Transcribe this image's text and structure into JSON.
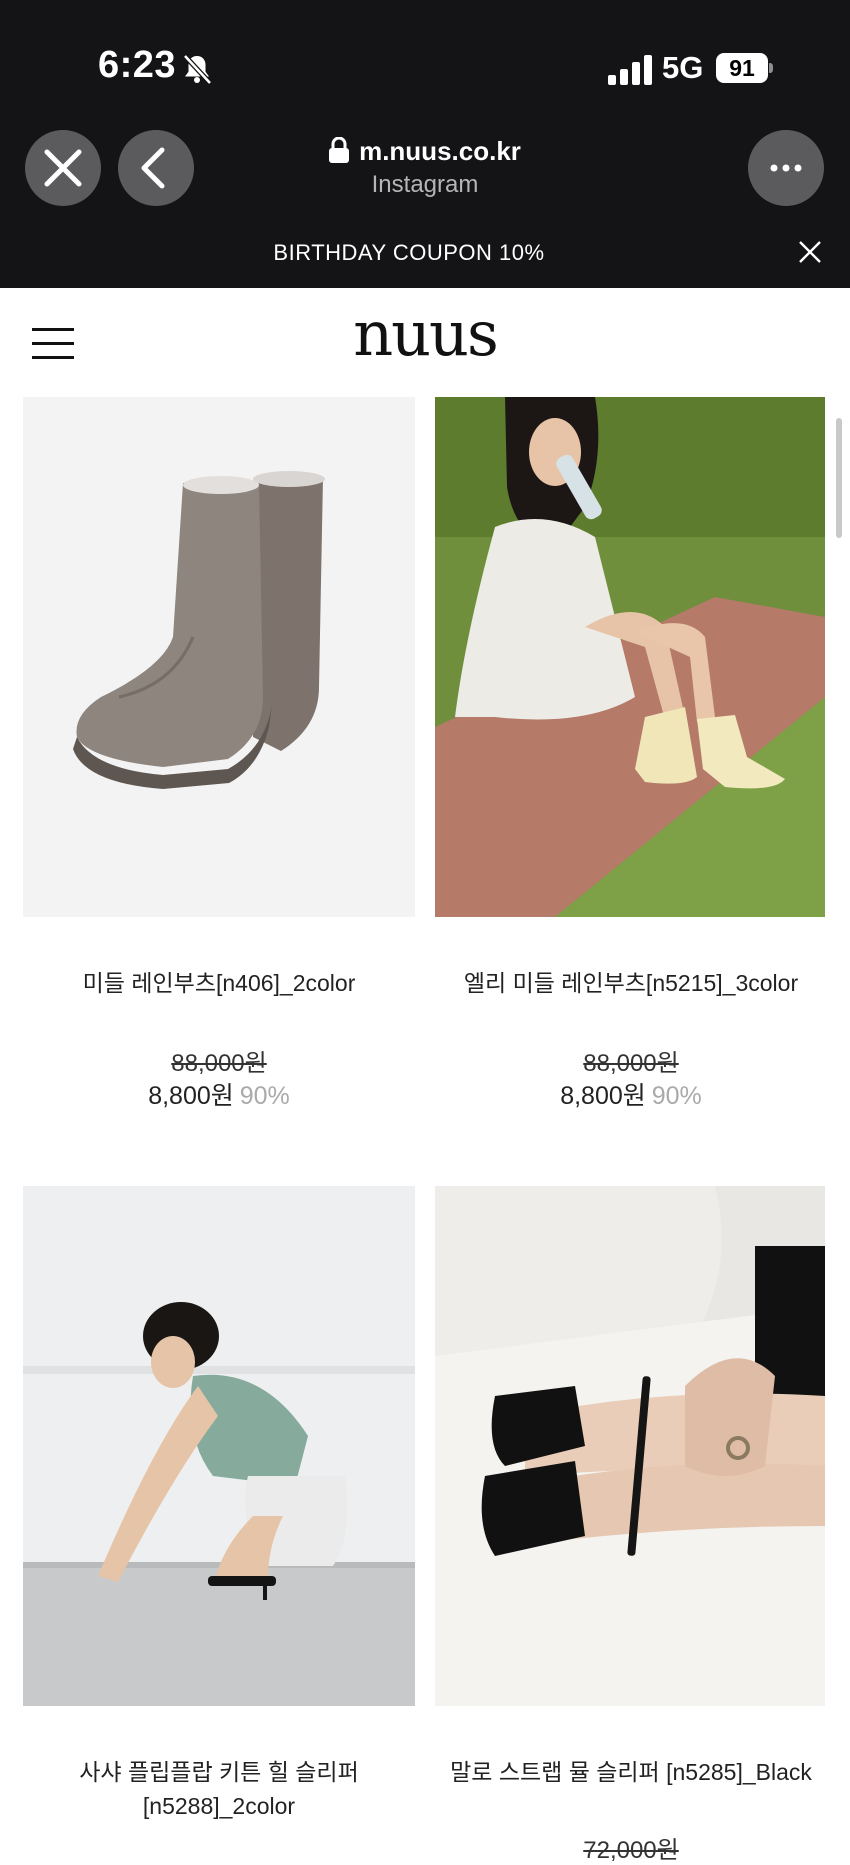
{
  "status": {
    "time": "6:23",
    "network": "5G",
    "battery": "91"
  },
  "browser": {
    "url": "m.nuus.co.kr",
    "source": "Instagram"
  },
  "banner": {
    "text": "BIRTHDAY COUPON 10%"
  },
  "site": {
    "logo": "nuus"
  },
  "products": [
    {
      "name": "미들 레인부츠[n406]_2color",
      "original_price": "88,000원",
      "price": "8,800원",
      "discount": "90%"
    },
    {
      "name": "엘리 미들 레인부츠[n5215]_3color",
      "original_price": "88,000원",
      "price": "8,800원",
      "discount": "90%"
    },
    {
      "name_line1": "사샤 플립플랍 키튼 힐 슬리퍼",
      "name_line2": "[n5288]_2color"
    },
    {
      "name": "말로 스트랩 뮬 슬리퍼 [n5285]_Black",
      "original_price": "72,000원"
    }
  ],
  "colors": {
    "topbar": "#141416",
    "discount": "#aaaaaa",
    "text": "#222222"
  }
}
